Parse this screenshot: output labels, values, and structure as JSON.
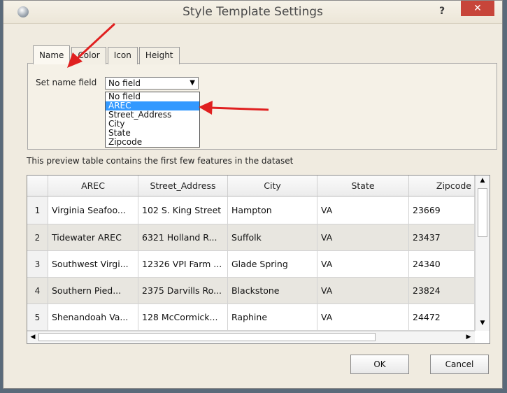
{
  "window": {
    "title": "Style Template Settings",
    "help_label": "?",
    "close_label": "✕"
  },
  "tabs": [
    {
      "label": "Name",
      "active": true
    },
    {
      "label": "Color",
      "active": false
    },
    {
      "label": "Icon",
      "active": false
    },
    {
      "label": "Height",
      "active": false
    }
  ],
  "name_field": {
    "label": "Set name field",
    "selected_value": "No field",
    "options": [
      "No field",
      "AREC",
      "Street_Address",
      "City",
      "State",
      "Zipcode"
    ],
    "highlighted": "AREC"
  },
  "preview_text": "This preview table contains the first few features in the dataset",
  "table": {
    "columns": [
      "AREC",
      "Street_Address",
      "City",
      "State",
      "Zipcode"
    ],
    "rows": [
      {
        "num": "1",
        "cells": [
          "Virginia Seafoo...",
          "102 S. King Street",
          "Hampton",
          "VA",
          "23669"
        ]
      },
      {
        "num": "2",
        "cells": [
          "Tidewater AREC",
          "6321 Holland R...",
          "Suffolk",
          "VA",
          "23437"
        ]
      },
      {
        "num": "3",
        "cells": [
          "Southwest Virgi...",
          "12326 VPI Farm ...",
          "Glade Spring",
          "VA",
          "24340"
        ]
      },
      {
        "num": "4",
        "cells": [
          "Southern Pied...",
          "2375 Darvills Ro...",
          "Blackstone",
          "VA",
          "23824"
        ]
      },
      {
        "num": "5",
        "cells": [
          "Shenandoah Va...",
          "128 McCormick...",
          "Raphine",
          "VA",
          "24472"
        ]
      }
    ]
  },
  "buttons": {
    "ok": "OK",
    "cancel": "Cancel"
  },
  "colors": {
    "annotation_arrow": "#e02020",
    "selection": "#3399ff",
    "close_button": "#c7453a"
  }
}
